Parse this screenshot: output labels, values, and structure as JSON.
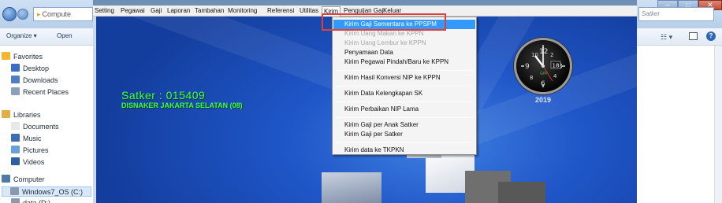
{
  "explorer": {
    "address": "Compute",
    "toolbar": {
      "organize": "Organize ▾",
      "open": "Open"
    },
    "nav": [
      {
        "label": "Favorites",
        "icon": "star-icon",
        "color": "#f2b630"
      },
      {
        "label": "Desktop",
        "icon": "desktop-icon",
        "color": "#3a6ec2"
      },
      {
        "label": "Downloads",
        "icon": "downloads-icon",
        "color": "#4f7fbf"
      },
      {
        "label": "Recent Places",
        "icon": "recent-places-icon",
        "color": "#8aa0b8"
      },
      {
        "label": "Libraries",
        "icon": "libraries-icon",
        "color": "#e0b048"
      },
      {
        "label": "Documents",
        "icon": "documents-icon",
        "color": "#e8e8e8"
      },
      {
        "label": "Music",
        "icon": "music-icon",
        "color": "#3f6fb0"
      },
      {
        "label": "Pictures",
        "icon": "pictures-icon",
        "color": "#6aa0d8"
      },
      {
        "label": "Videos",
        "icon": "videos-icon",
        "color": "#2e5f9e"
      },
      {
        "label": "Computer",
        "icon": "computer-icon",
        "color": "#4e78a8"
      },
      {
        "label": "Windows7_OS (C:)",
        "icon": "drive-icon",
        "color": "#8a9aae"
      },
      {
        "label": "data (D:)",
        "icon": "drive-icon",
        "color": "#8a9aae"
      }
    ]
  },
  "right_pane": {
    "search_placeholder": "Satker"
  },
  "app": {
    "menu": [
      "Setting",
      "Pegawai",
      "Gaji",
      "Laporan",
      "Tambahan",
      "Monitoring",
      "Referensi",
      "Utilitas",
      "Kirim",
      "Penguijan Gaji",
      "Keluar"
    ],
    "active_menu": "Kirim",
    "satker_line": "Satker : 015409",
    "dinas_line": "DISNAKER JAKARTA SELATAN (08)",
    "clock_year": "2019",
    "clock_date": "18"
  },
  "kirim_menu": {
    "items": [
      {
        "label": "Kirim Gaji Sementara ke PPSPM",
        "state": "active"
      },
      {
        "label": "Kirim Uang Makan ke KPPN",
        "state": "disabled"
      },
      {
        "label": "Kirim Uang Lembur ke KPPN",
        "state": "disabled"
      },
      {
        "label": "Penyamaan Data",
        "state": "normal"
      },
      {
        "label": "Kirim Pegawai Pindah/Baru ke KPPN",
        "state": "normal"
      },
      {
        "label": "Kirim Hasil Konversi NIP ke KPPN",
        "state": "normal"
      },
      {
        "label": "Kirim Data Kelengkapan SK",
        "state": "normal"
      },
      {
        "label": "Kirim Perbaikan NIP Lama",
        "state": "normal"
      },
      {
        "label": "Kirim Gaji per Anak Satker",
        "state": "normal"
      },
      {
        "label": "Kirim Gaji per Satker",
        "state": "normal"
      },
      {
        "label": "Kirim data ke TKPKN",
        "state": "normal"
      }
    ]
  },
  "colors": {
    "highlight": "#e0403a",
    "satker_text": "#3cff57",
    "menu_active": "#3399ff"
  }
}
